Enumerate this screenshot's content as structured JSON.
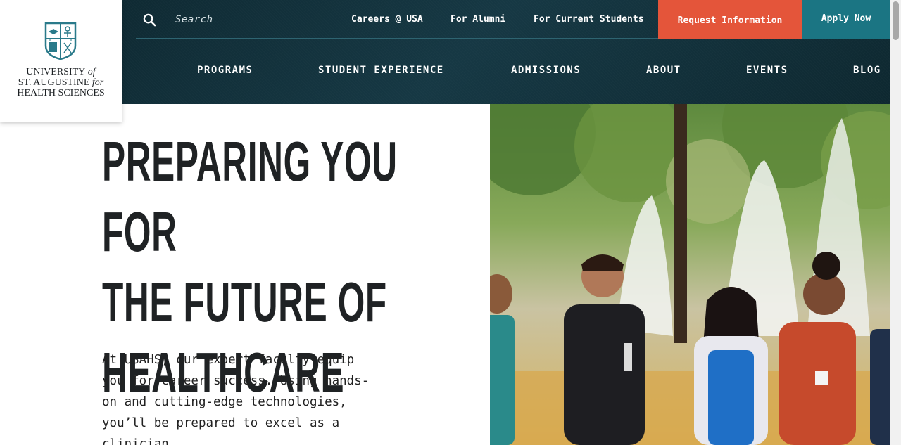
{
  "logo": {
    "line1": "UNIVERSITY",
    "line1_suffix": "of",
    "line2": "ST. AUGUSTINE",
    "line2_suffix": "for",
    "line3": "HEALTH SCIENCES"
  },
  "header": {
    "search_placeholder": "Search",
    "utility_links": [
      "Careers @ USA",
      "For Alumni",
      "For Current Students"
    ],
    "request_info_label": "Request Information",
    "apply_now_label": "Apply Now",
    "nav": [
      "PROGRAMS",
      "STUDENT EXPERIENCE",
      "ADMISSIONS",
      "ABOUT",
      "EVENTS",
      "BLOG"
    ]
  },
  "hero": {
    "title_lines": [
      "PREPARING YOU FOR",
      "THE FUTURE OF",
      "HEALTHCARE"
    ],
    "body": "At USAHS, our expert faculty equip you for career success. Using hands-on and cutting-edge technologies, you’ll be prepared to excel as a clinician."
  },
  "colors": {
    "header_bg": "#163844",
    "request_button": "#e4553a",
    "apply_button": "#1b7583",
    "title_text": "#1f2224"
  },
  "icons": {
    "search": "search-icon",
    "logo_emblem": "university-shield-icon"
  }
}
